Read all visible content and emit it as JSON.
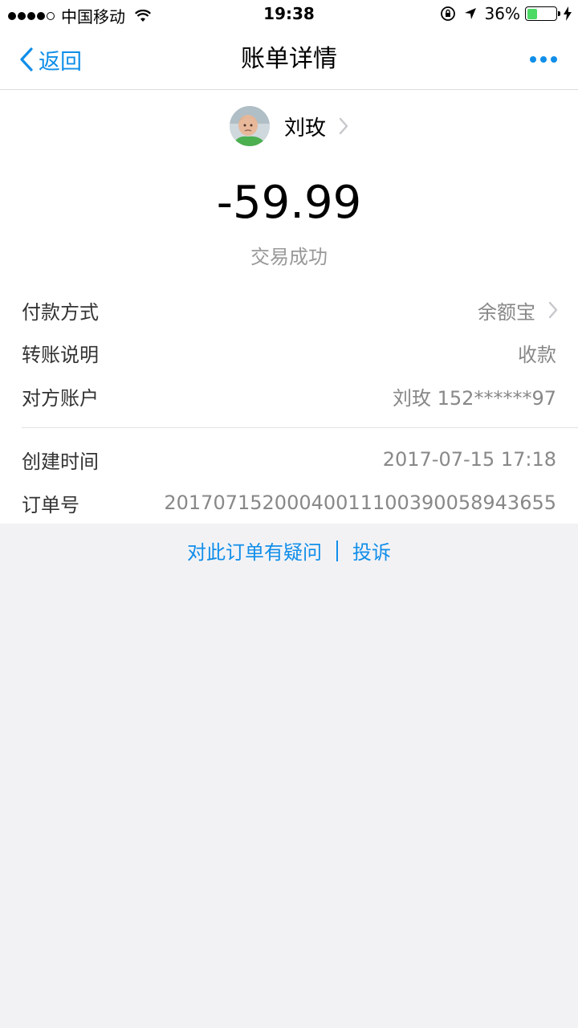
{
  "status_bar": {
    "carrier": "中国移动",
    "time": "19:38",
    "battery": "36%",
    "battery_level": 0.36,
    "icons": [
      "wifi-icon",
      "rotation-lock-icon",
      "location-arrow-icon",
      "charging-icon"
    ]
  },
  "nav": {
    "back_label": "返回",
    "title": "账单详情",
    "more_icon": "more-icon"
  },
  "payee": {
    "name": "刘玫"
  },
  "transaction": {
    "amount": "-59.99",
    "status": "交易成功"
  },
  "details": [
    {
      "label": "付款方式",
      "value": "余额宝",
      "has_arrow": true
    },
    {
      "label": "转账说明",
      "value": "收款"
    },
    {
      "label": "对方账户",
      "value": "刘玫 152******97"
    },
    {
      "label": "创建时间",
      "value": "2017-07-15 17:18"
    },
    {
      "label": "订单号",
      "value": "20170715200040011100390058943655"
    }
  ],
  "footer": {
    "question_link": "对此订单有疑问",
    "complaint_link": "投诉"
  },
  "colors": {
    "accent": "#108ee9",
    "background": "#f2f2f5",
    "muted_text": "#888888",
    "battery_green": "#4cd964"
  }
}
